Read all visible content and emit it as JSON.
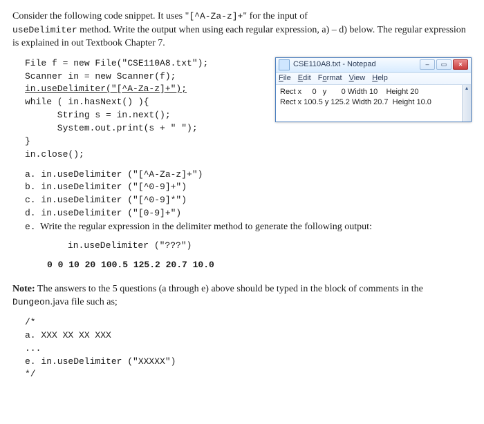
{
  "intro": {
    "p1a": "Consider the following code snippet. It uses \"",
    "regex": "[^A-Za-z]+",
    "p1b": "\" for the input of ",
    "p2a": "useDelimiter",
    "p2b": " method. Write the output when using each regular expression, a) – d) below. The regular expression is explained in out Textbook Chapter 7."
  },
  "code": {
    "l1": "File f = new File(\"CSE110A8.txt\");",
    "l2": "Scanner in = new Scanner(f);",
    "l3": "in.useDelimiter(\"[^A-Za-z]+\");",
    "l4": "while ( in.hasNext() ){",
    "l5": "      String s = in.next();",
    "l6": "      System.out.print(s + \" \");",
    "l7": "}",
    "l8": "in.close();"
  },
  "notepad": {
    "title": "CSE110A8.txt - Notepad",
    "menu": {
      "m1": "File",
      "m2": "Edit",
      "m3": "Format",
      "m4": "View",
      "m5": "Help"
    },
    "line1": "Rect x     0   y       0 Width 10    Height 20",
    "line2": "Rect x 100.5 y 125.2 Width 20.7  Height 10.0"
  },
  "options": {
    "a": "a. in.useDelimiter (\"[^A-Za-z]+\")",
    "b": "b. in.useDelimiter (\"[^0-9]+\")",
    "c": "c. in.useDelimiter (\"[^0-9]*\")",
    "d": "d. in.useDelimiter (\"[0-9]+\")",
    "e_letter": "e.",
    "e_text": "Write the regular expression in the delimiter method to generate the following output:",
    "e_code": "in.useDelimiter (\"???\")",
    "e_out": "0 0 10 20 100.5 125.2 20.7 10.0"
  },
  "note": {
    "bold": "Note:",
    "t1": " The answers to the 5 questions (a through e) above should be typed in the block of comments in the ",
    "mono": "Dungeon",
    "t2": ".java file such as;"
  },
  "sample": {
    "s1": "/*",
    "s2": "a. XXX XX XX XXX",
    "s3": "...",
    "s4": "e. in.useDelimiter (\"XXXXX\")",
    "s5": "*/"
  }
}
